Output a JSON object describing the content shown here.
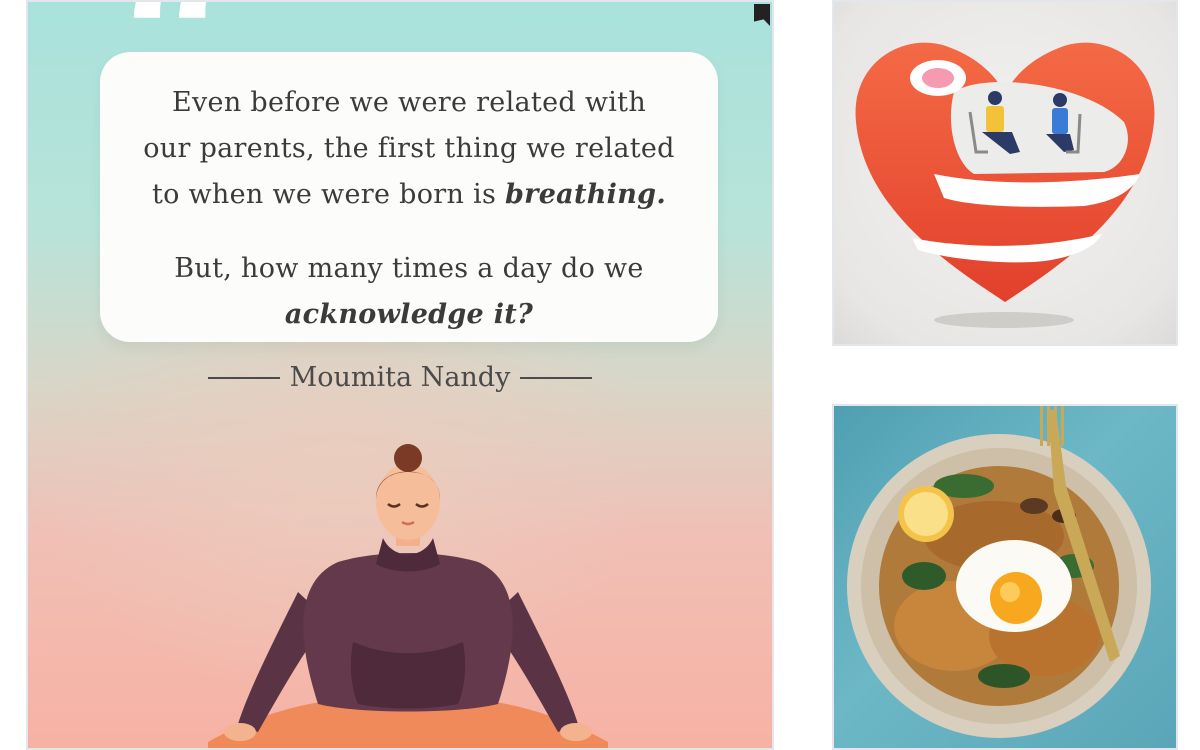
{
  "quote": {
    "paragraph1": {
      "line1": "Even before we were related with",
      "line2": "our parents, the first thing we related",
      "line3_prefix": "to when we were born is ",
      "line3_emphasis": "breathing."
    },
    "paragraph2": {
      "line1": "But, how many times a day do we",
      "line2_emphasis": "acknowledge it?"
    },
    "author": "Moumita Nandy"
  },
  "images": {
    "main": "meditating-woman-quote-illustration",
    "top_right": "heart-therapy-session-illustration",
    "bottom_right": "pasta-bowl-with-fried-egg-photo"
  },
  "colors": {
    "teal": "#a9e2dc",
    "peach": "#f6b2a4",
    "heart_red": "#ef5a3a",
    "bubble": "#fcfcfa"
  }
}
